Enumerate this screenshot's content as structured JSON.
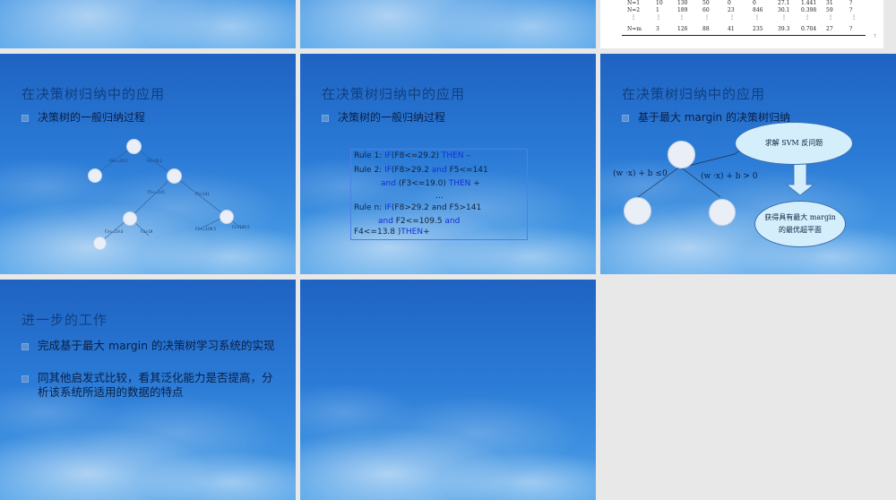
{
  "slides": {
    "table": {
      "rows": [
        [
          "N=1",
          "10",
          "130",
          "50",
          "0",
          "0",
          "27.1",
          "1.441",
          "31",
          "?"
        ],
        [
          "N=2",
          "1",
          "189",
          "60",
          "23",
          "846",
          "30.1",
          "0.398",
          "59",
          "?"
        ],
        [
          "⋮",
          "⋮",
          "⋮",
          "⋮",
          "⋮",
          "⋮",
          "⋮",
          "⋮",
          "⋮",
          "⋮"
        ],
        [
          "N=m",
          "3",
          "126",
          "88",
          "41",
          "235",
          "39.3",
          "0.704",
          "27",
          "?"
        ]
      ],
      "page_number": "7"
    },
    "s4": {
      "title": "在决策树归纳中的应用",
      "bullet": "决策树的一般归纳过程",
      "edge_labels": [
        "F8<=29.2",
        "F8>29.2",
        "F5<=141",
        "F5>141",
        "F3<=19.0",
        "F3>19",
        "F2<=109.5",
        "F2>109.5"
      ]
    },
    "s5": {
      "title": "在决策树归纳中的应用",
      "bullet": "决策树的一般归纳过程",
      "rules": {
        "l1_a": "Rule 1: ",
        "l1_if": "IF",
        "l1_cond": "(F8<=29.2) ",
        "l1_then": "THEN",
        "l1_end": " –",
        "l2_a": "Rule 2: ",
        "l2_if": "IF",
        "l2_cond": "(F8>29.2 ",
        "l2_and": "and",
        "l2_cond2": " F5<=141",
        "l3_and": "and",
        "l3_cond": " (F3<=19.0) ",
        "l3_then": "THEN",
        "l3_end": " +",
        "ellipsis": "…",
        "ln_a": "Rule n: ",
        "ln_if": "IF",
        "ln_cond": "(F8>29.2 and F5>141",
        "ln2_and": "and",
        "ln2_cond": "  F2<=109.5 ",
        "ln2_and2": "and",
        "ln3_cond": "F4<=13.8 )",
        "ln3_then": "THEN",
        "ln3_end": "+"
      }
    },
    "s6": {
      "title": "在决策树归纳中的应用",
      "bullet": "基于最大 margin 的决策树归纳",
      "math_left": "(w ·x) + b ≤0",
      "math_right": "(w ·x) + b > 0",
      "bubble_top": "求解 SVM 反问题",
      "bubble_bottom_1": "获得具有最大 margin",
      "bubble_bottom_2": "的最优超平面"
    },
    "s7": {
      "title": "进一步的工作",
      "bullets": [
        "完成基于最大 margin 的决策树学习系统的实现",
        "同其他启发式比较，看其泛化能力是否提高，分析该系统所适用的数据的特点"
      ]
    }
  },
  "colors": {
    "panel_bg": "#e8e8e8",
    "title": "#123f7d",
    "rule_keyword": "#1230d8",
    "rule_border": "#4d7fe8"
  }
}
